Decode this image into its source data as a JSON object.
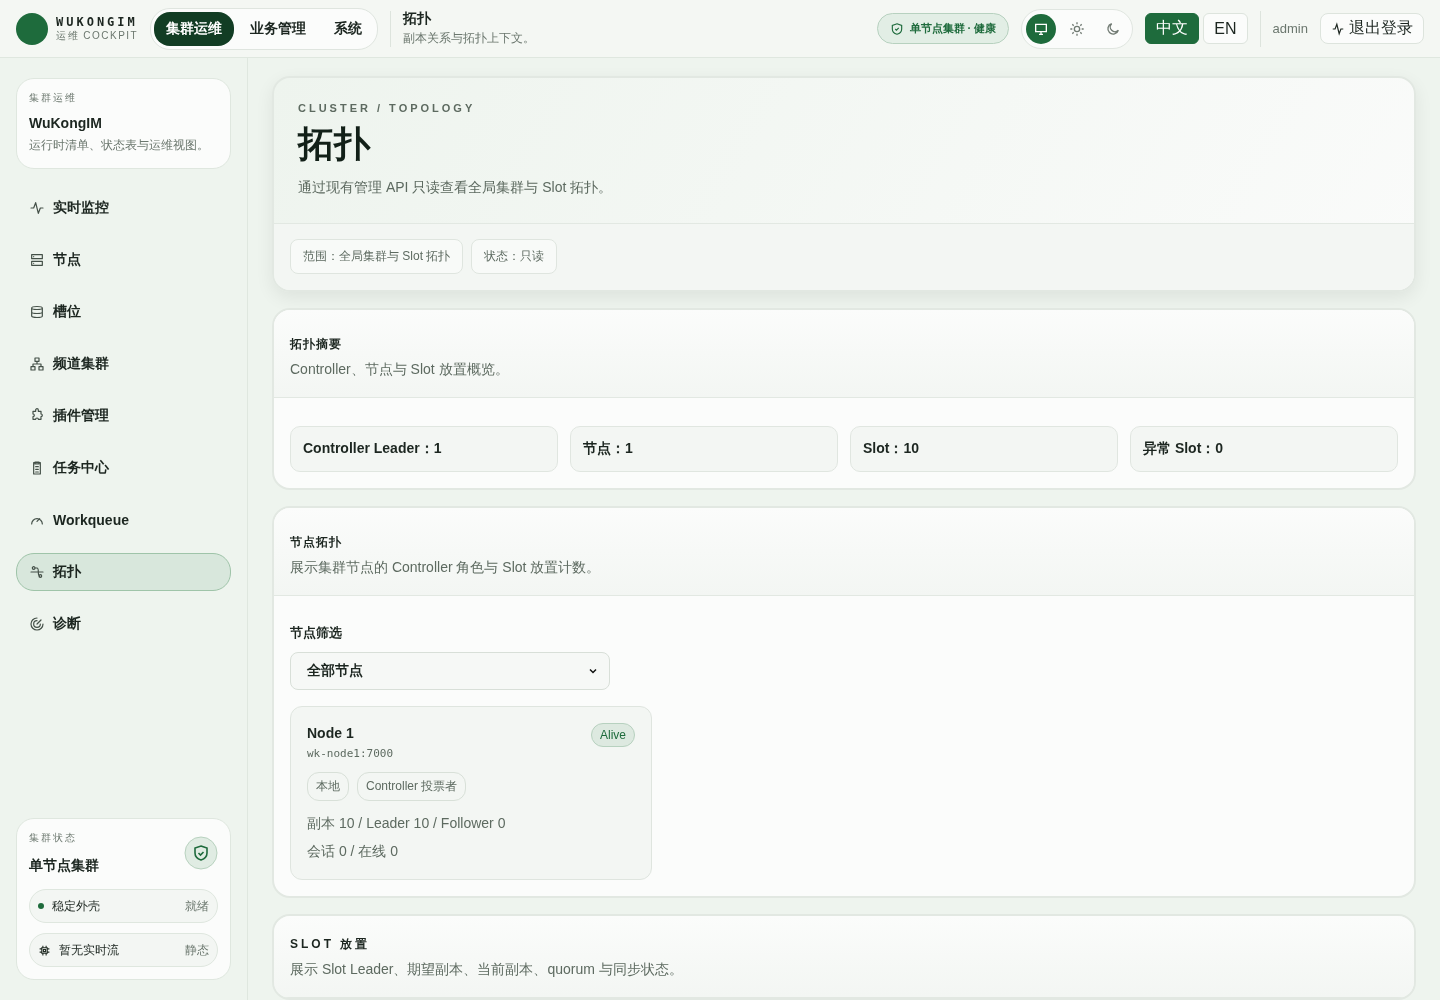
{
  "brand": {
    "name": "WUKONGIM",
    "sub": "运维 COCKPIT"
  },
  "top_tabs": [
    {
      "label": "集群运维",
      "selected": true
    },
    {
      "label": "业务管理",
      "selected": false
    },
    {
      "label": "系统",
      "selected": false
    }
  ],
  "page_heading": {
    "title": "拓扑",
    "subtitle": "副本关系与拓扑上下文。"
  },
  "health_badge": "单节点集群 · 健康",
  "theme_buttons": [
    {
      "kind": "system",
      "selected": true
    },
    {
      "kind": "light",
      "selected": false
    },
    {
      "kind": "dark",
      "selected": false
    }
  ],
  "languages": [
    {
      "label": "中文",
      "selected": true
    },
    {
      "label": "EN",
      "selected": false
    }
  ],
  "user": "admin",
  "logout": "退出登录",
  "sidebar": {
    "card": {
      "eyebrow": "集群运维",
      "title": "WuKongIM",
      "desc": "运行时清单、状态表与运维视图。"
    },
    "items": [
      {
        "label": "实时监控",
        "selected": false
      },
      {
        "label": "节点",
        "selected": false
      },
      {
        "label": "槽位",
        "selected": false
      },
      {
        "label": "频道集群",
        "selected": false
      },
      {
        "label": "插件管理",
        "selected": false
      },
      {
        "label": "任务中心",
        "selected": false
      },
      {
        "label": "Workqueue",
        "selected": false
      },
      {
        "label": "拓扑",
        "selected": true
      },
      {
        "label": "诊断",
        "selected": false
      }
    ],
    "status": {
      "eyebrow": "集群状态",
      "title": "单节点集群",
      "rows": [
        {
          "kind": "dot",
          "label": "稳定外壳",
          "value": "就绪"
        },
        {
          "kind": "chip",
          "label": "暂无实时流",
          "value": "静态"
        }
      ]
    }
  },
  "hero": {
    "eyebrow": "CLUSTER / TOPOLOGY",
    "title": "拓扑",
    "desc": "通过现有管理 API 只读查看全局集群与 Slot 拓扑。",
    "chips": [
      "范围：全局集群与 Slot 拓扑",
      "状态：只读"
    ]
  },
  "summary": {
    "title": "拓扑摘要",
    "desc": "Controller、节点与 Slot 放置概览。",
    "stats": [
      "Controller Leader：1",
      "节点：1",
      "Slot：10",
      "异常 Slot：0"
    ]
  },
  "node_topology": {
    "title": "节点拓扑",
    "desc": "展示集群节点的 Controller 角色与 Slot 放置计数。",
    "filter_label": "节点筛选",
    "filter_value": "全部节点",
    "nodes": [
      {
        "name": "Node 1",
        "addr": "wk-node1:7000",
        "status": "Alive",
        "tags": [
          "本地",
          "Controller 投票者"
        ],
        "replicas": "副本 10 / Leader 10 / Follower 0",
        "sessions": "会话 0 / 在线 0"
      }
    ]
  },
  "slot_placement": {
    "title": "SLOT 放置",
    "desc": "展示 Slot Leader、期望副本、当前副本、quorum 与同步状态。"
  }
}
